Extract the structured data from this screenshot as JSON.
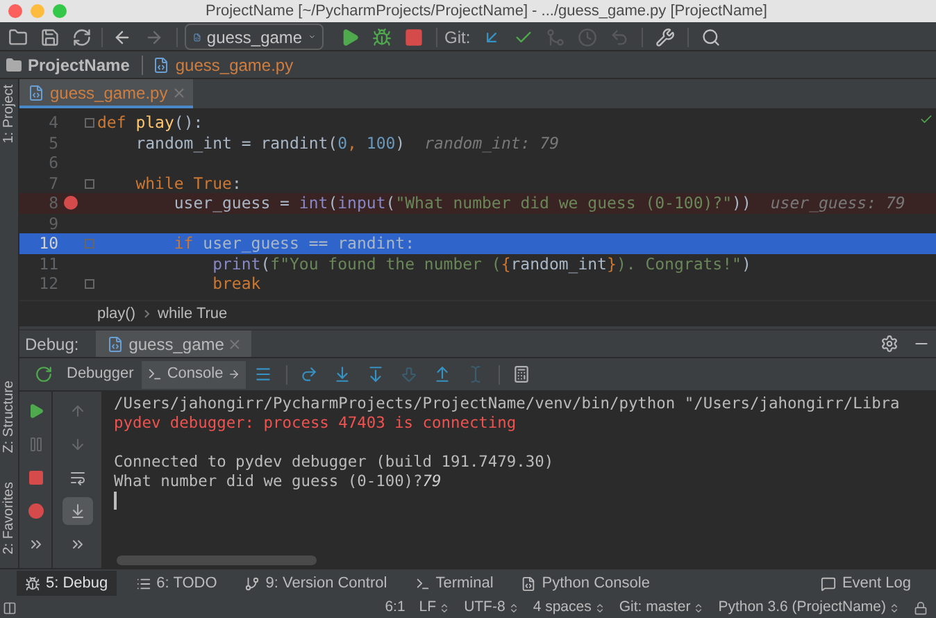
{
  "window": {
    "title": "ProjectName [~/PycharmProjects/ProjectName] - .../guess_game.py [ProjectName]"
  },
  "toolbar": [
    {
      "kind": "open",
      "disabled": false
    },
    {
      "kind": "save",
      "disabled": false
    },
    {
      "kind": "sync",
      "disabled": false
    },
    {
      "kind": "back",
      "disabled": false
    },
    {
      "kind": "forward",
      "disabled": true
    }
  ],
  "run_config": {
    "label": "guess_game"
  },
  "run_buttons": [
    {
      "kind": "run",
      "disabled": false
    },
    {
      "kind": "debug",
      "disabled": false
    },
    {
      "kind": "stop",
      "disabled": false
    }
  ],
  "git": {
    "label": "Git:",
    "buttons": [
      {
        "kind": "update",
        "disabled": false
      },
      {
        "kind": "commit",
        "disabled": false
      },
      {
        "kind": "compare",
        "disabled": true
      },
      {
        "kind": "history",
        "disabled": true
      },
      {
        "kind": "revert",
        "disabled": true
      }
    ]
  },
  "nav": {
    "project": "ProjectName",
    "file": "guess_game.py"
  },
  "side_tools": [
    {
      "label": "1: Project"
    },
    {
      "label": "Z: Structure"
    },
    {
      "label": "2: Favorites"
    }
  ],
  "editor_tabs": [
    {
      "label": "guess_game.py",
      "selected": true
    }
  ],
  "code": [
    {
      "number": "4",
      "breakpoint": false,
      "current": false,
      "fold": true,
      "tokens": [
        {
          "text": "def ",
          "kind": "kw"
        },
        {
          "text": "play",
          "kind": "fn"
        },
        {
          "text": "():",
          "kind": "plain"
        }
      ]
    },
    {
      "number": "5",
      "breakpoint": false,
      "current": false,
      "fold": false,
      "tokens": [
        {
          "text": "    random_int = randint(",
          "kind": "plain"
        },
        {
          "text": "0",
          "kind": "num"
        },
        {
          "text": ", ",
          "kind": "kw"
        },
        {
          "text": "100",
          "kind": "num"
        },
        {
          "text": ")",
          "kind": "plain"
        }
      ],
      "hint": "random_int: 79"
    },
    {
      "number": "6",
      "breakpoint": false,
      "current": false,
      "fold": false
    },
    {
      "number": "7",
      "breakpoint": false,
      "current": false,
      "fold": true,
      "tokens": [
        {
          "text": "    while True",
          "kind": "kw"
        },
        {
          "text": ":",
          "kind": "plain"
        }
      ]
    },
    {
      "number": "8",
      "breakpoint": true,
      "current": false,
      "fold": false,
      "tokens": [
        {
          "text": "        user_guess = ",
          "kind": "plain"
        },
        {
          "text": "int",
          "kind": "builtin"
        },
        {
          "text": "(",
          "kind": "plain"
        },
        {
          "text": "input",
          "kind": "builtin"
        },
        {
          "text": "(",
          "kind": "plain"
        },
        {
          "text": "\"What number did we guess (0-100)?\"",
          "kind": "str"
        },
        {
          "text": "))",
          "kind": "plain"
        }
      ],
      "hint": "user_guess: 79"
    },
    {
      "number": "9",
      "breakpoint": false,
      "current": false,
      "fold": false
    },
    {
      "number": "10",
      "breakpoint": false,
      "current": true,
      "fold": true,
      "tokens": [
        {
          "text": "        if ",
          "kind": "kw"
        },
        {
          "text": "user_guess == randint:",
          "kind": "plain"
        }
      ]
    },
    {
      "number": "11",
      "breakpoint": false,
      "current": false,
      "fold": false,
      "tokens": [
        {
          "text": "            print",
          "kind": "builtin"
        },
        {
          "text": "(",
          "kind": "plain"
        },
        {
          "text": "f\"You found the number (",
          "kind": "str"
        },
        {
          "text": "{",
          "kind": "kw"
        },
        {
          "text": "random_int",
          "kind": "plain"
        },
        {
          "text": "}",
          "kind": "kw"
        },
        {
          "text": "). Congrats!\"",
          "kind": "str"
        },
        {
          "text": ")",
          "kind": "plain"
        }
      ]
    },
    {
      "number": "12",
      "breakpoint": false,
      "current": false,
      "fold": true,
      "tokens": [
        {
          "text": "            break",
          "kind": "kw"
        }
      ]
    }
  ],
  "code_breadcrumb": [
    "play()",
    "while True"
  ],
  "debug": {
    "label": "Debug:",
    "tabs": [
      {
        "label": "guess_game",
        "selected": true
      }
    ],
    "subtabs": [
      {
        "label": "Debugger",
        "selected": false,
        "kind": "plain"
      },
      {
        "label": "Console",
        "selected": true,
        "kind": "console"
      }
    ],
    "steps": [
      {
        "kind": "menu",
        "disabled": false
      },
      {
        "kind": "step-over",
        "disabled": false
      },
      {
        "kind": "step-into",
        "disabled": false
      },
      {
        "kind": "step-my",
        "disabled": false
      },
      {
        "kind": "force-step",
        "disabled": true
      },
      {
        "kind": "step-out",
        "disabled": false
      },
      {
        "kind": "cursor",
        "disabled": true
      },
      {
        "kind": "evaluate",
        "disabled": false
      }
    ],
    "left": [
      {
        "kind": "resume",
        "disabled": false
      },
      {
        "kind": "pause",
        "disabled": true
      },
      {
        "kind": "stop",
        "disabled": false
      },
      {
        "kind": "breakpoints",
        "disabled": false
      },
      {
        "kind": "more",
        "disabled": false
      }
    ],
    "right": [
      {
        "kind": "up",
        "disabled": true,
        "selected": false
      },
      {
        "kind": "down",
        "disabled": true,
        "selected": false
      },
      {
        "kind": "wrap",
        "disabled": false,
        "selected": false
      },
      {
        "kind": "scroll-end",
        "disabled": false,
        "selected": true
      },
      {
        "kind": "more",
        "disabled": false,
        "selected": false
      }
    ],
    "console": [
      {
        "kind": "normal",
        "text": "/Users/jahongirr/PycharmProjects/ProjectName/venv/bin/python \"/Users/jahongirr/Libra"
      },
      {
        "kind": "error",
        "text": "pydev debugger: process 47403 is connecting"
      },
      {
        "kind": "blank"
      },
      {
        "kind": "normal",
        "text": "Connected to pydev debugger (build 191.7479.30)"
      },
      {
        "kind": "input",
        "text": "What number did we guess (0-100)?",
        "input": "79"
      }
    ]
  },
  "tool_tabs": [
    {
      "label": "5: Debug",
      "kind": "debug",
      "selected": true
    },
    {
      "label": "6: TODO",
      "kind": "todo",
      "selected": false
    },
    {
      "label": "9: Version Control",
      "kind": "vcs",
      "selected": false
    },
    {
      "label": "Terminal",
      "kind": "terminal",
      "selected": false
    },
    {
      "label": "Python Console",
      "kind": "python",
      "selected": false
    },
    {
      "label": "Event Log",
      "kind": "log",
      "selected": false
    }
  ],
  "status": [
    {
      "text": "6:1",
      "dropdown": false
    },
    {
      "text": "LF",
      "dropdown": true
    },
    {
      "text": "UTF-8",
      "dropdown": true
    },
    {
      "text": "4 spaces",
      "dropdown": true
    },
    {
      "text": "Git: master",
      "dropdown": true
    },
    {
      "text": "Python 3.6 (ProjectName)",
      "dropdown": true
    }
  ]
}
